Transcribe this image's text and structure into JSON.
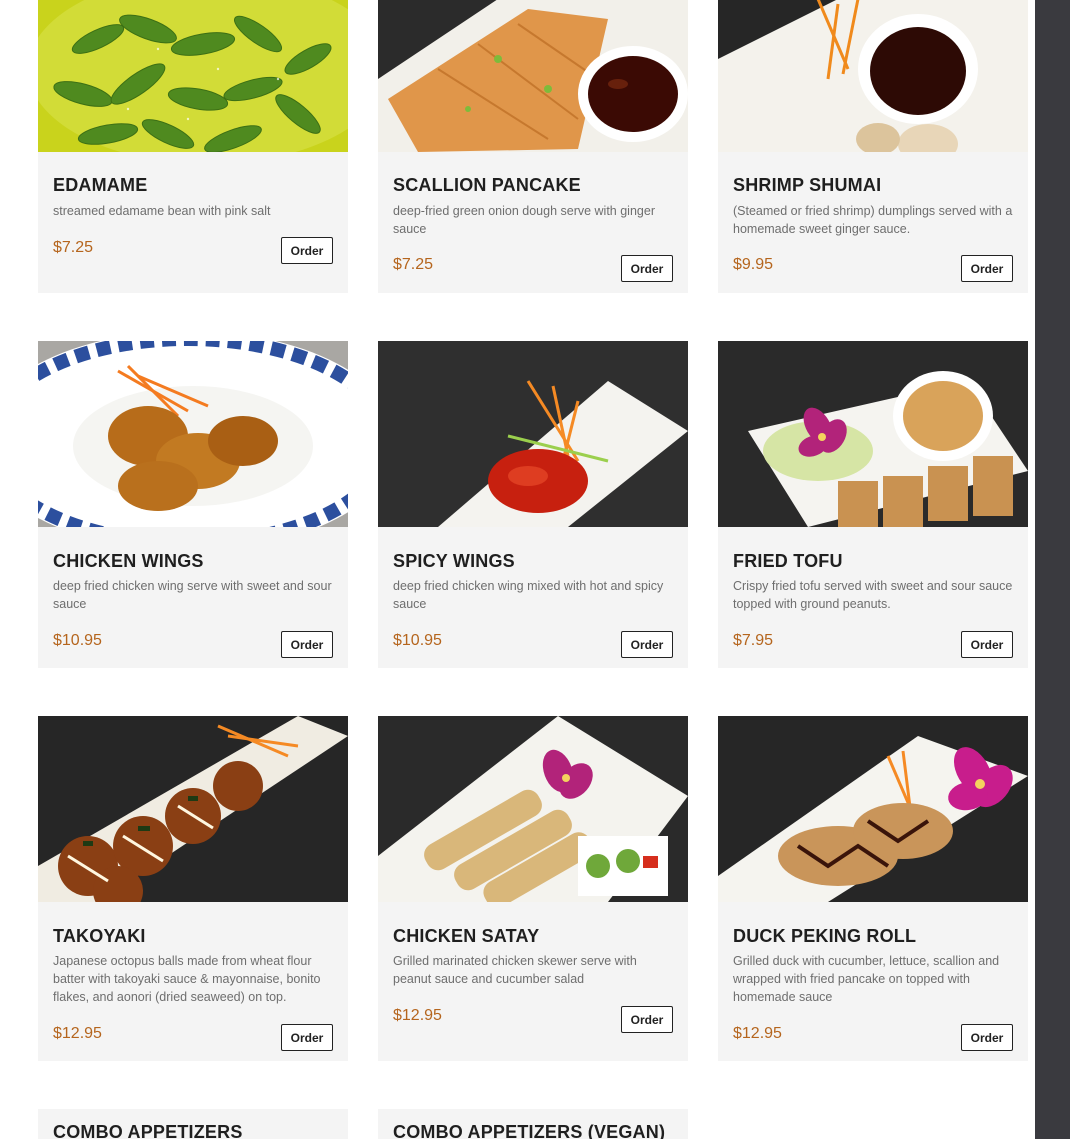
{
  "menu": {
    "items": [
      {
        "name": "EDAMAME",
        "description": "streamed edamame bean with pink salt",
        "price": "$7.25",
        "order_label": "Order"
      },
      {
        "name": "SCALLION PANCAKE",
        "description": "deep-fried green onion dough serve with ginger sauce",
        "price": "$7.25",
        "order_label": "Order"
      },
      {
        "name": "SHRIMP SHUMAI",
        "description": "(Steamed or fried shrimp) dumplings served with a homemade sweet ginger sauce.",
        "price": "$9.95",
        "order_label": "Order"
      },
      {
        "name": "CHICKEN WINGS",
        "description": "deep fried chicken wing serve with sweet and sour sauce",
        "price": "$10.95",
        "order_label": "Order"
      },
      {
        "name": "SPICY WINGS",
        "description": "deep fried chicken wing mixed with hot and spicy sauce",
        "price": "$10.95",
        "order_label": "Order"
      },
      {
        "name": "FRIED TOFU",
        "description": "Crispy fried tofu served with sweet and sour sauce topped with ground peanuts.",
        "price": "$7.95",
        "order_label": "Order"
      },
      {
        "name": "TAKOYAKI",
        "description": "Japanese octopus balls made from wheat flour batter with takoyaki sauce & mayonnaise, bonito flakes, and aonori (dried seaweed) on top.",
        "price": "$12.95",
        "order_label": "Order"
      },
      {
        "name": "CHICKEN SATAY",
        "description": "Grilled marinated chicken skewer serve with peanut sauce and cucumber salad",
        "price": "$12.95",
        "order_label": "Order"
      },
      {
        "name": "DUCK PEKING ROLL",
        "description": "Grilled duck with cucumber, lettuce, scallion and wrapped with fried pancake on topped with homemade sauce",
        "price": "$12.95",
        "order_label": "Order"
      },
      {
        "name": "COMBO APPETIZERS"
      },
      {
        "name": "COMBO APPETIZERS (VEGAN)"
      }
    ]
  },
  "colors": {
    "card_background": "#f4f4f4",
    "price": "#b5651d",
    "title": "#1f1f1f",
    "description": "#6e6e6e",
    "scrollbar": "#3a3a3f"
  }
}
